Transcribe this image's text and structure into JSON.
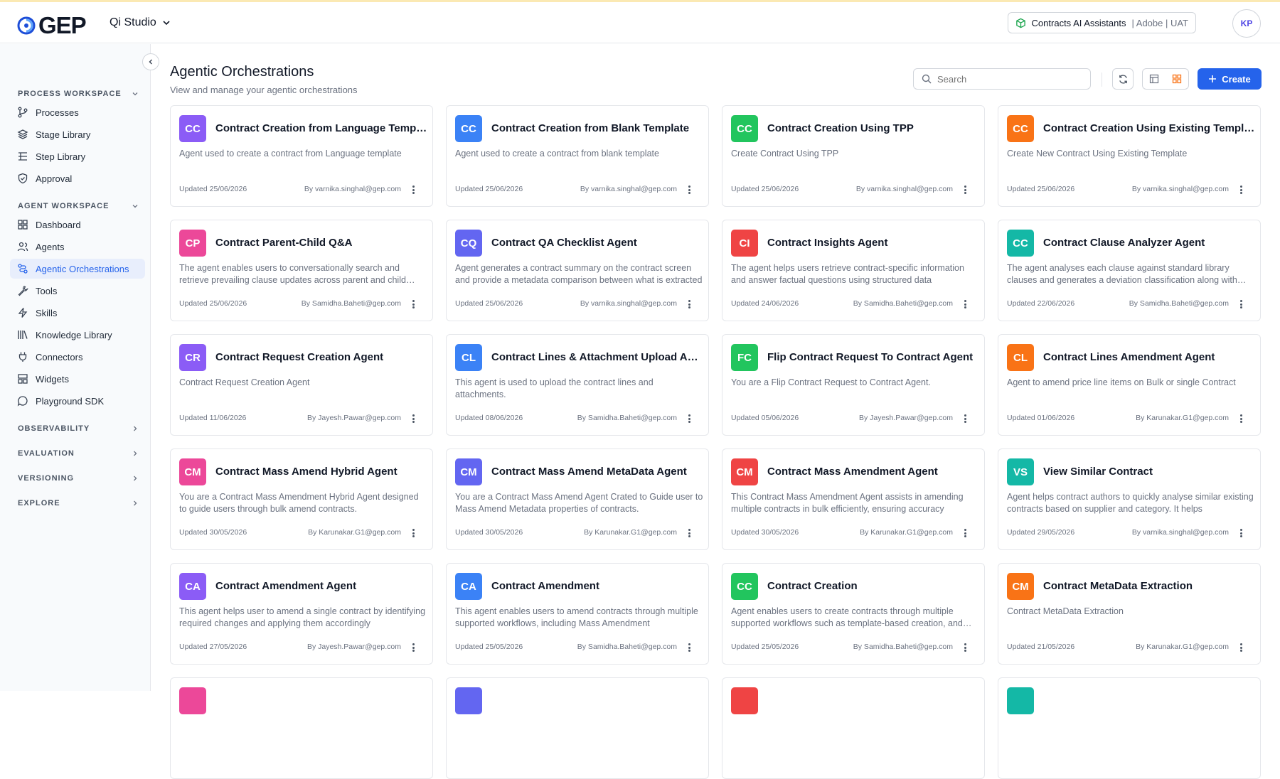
{
  "header": {
    "brand": "GEP",
    "studio_name": "Qi Studio",
    "context_name": "Contracts AI Assistants",
    "context_meta": "| Adobe | UAT",
    "user_initials": "KP"
  },
  "sidebar": {
    "sections": {
      "process": "PROCESS WORKSPACE",
      "agent": "AGENT WORKSPACE",
      "observability": "OBSERVABILITY",
      "evaluation": "EVALUATION",
      "versioning": "VERSIONING",
      "explore": "EXPLORE"
    },
    "process_items": [
      "Processes",
      "Stage Library",
      "Step Library",
      "Approval"
    ],
    "agent_items": [
      "Dashboard",
      "Agents",
      "Agentic Orchestrations",
      "Tools",
      "Skills",
      "Knowledge Library",
      "Connectors",
      "Widgets",
      "Playground SDK"
    ],
    "active_item": "Agentic Orchestrations"
  },
  "page": {
    "title": "Agentic Orchestrations",
    "subtitle": "View and manage your agentic orchestrations",
    "search_placeholder": "Search",
    "create_label": "Create",
    "active_view": "grid"
  },
  "colors": {
    "accent": "#2563eb",
    "purple": "#8b5cf6",
    "blue": "#3b82f6",
    "green": "#22c55e",
    "orange": "#f97316",
    "pink": "#ec4899",
    "indigo": "#6366f1",
    "red": "#ef4444",
    "teal": "#14b8a6"
  },
  "cards": [
    {
      "initials": "CC",
      "color": "#8b5cf6",
      "title": "Contract Creation from Language Template",
      "desc": "Agent used to create a contract from Language template",
      "updated": "Updated 25/06/2026",
      "by": "By varnika.singhal@gep.com"
    },
    {
      "initials": "CC",
      "color": "#3b82f6",
      "title": "Contract Creation from Blank Template",
      "desc": "Agent used to create a contract from blank template",
      "updated": "Updated 25/06/2026",
      "by": "By varnika.singhal@gep.com"
    },
    {
      "initials": "CC",
      "color": "#22c55e",
      "title": "Contract Creation Using TPP",
      "desc": "Create Contract Using TPP",
      "updated": "Updated 25/06/2026",
      "by": "By varnika.singhal@gep.com"
    },
    {
      "initials": "CC",
      "color": "#f97316",
      "title": "Contract Creation Using Existing Template",
      "desc": "Create New Contract Using Existing Template",
      "updated": "Updated 25/06/2026",
      "by": "By varnika.singhal@gep.com"
    },
    {
      "initials": "CP",
      "color": "#ec4899",
      "title": "Contract Parent-Child Q&A",
      "desc": "The agent enables users to conversationally search and retrieve prevailing clause updates across parent and child contracts",
      "updated": "Updated 25/06/2026",
      "by": "By Samidha.Baheti@gep.com"
    },
    {
      "initials": "CQ",
      "color": "#6366f1",
      "title": "Contract QA Checklist Agent",
      "desc": "Agent generates a contract summary on the contract screen and provide a metadata comparison between what is extracted",
      "updated": "Updated 25/06/2026",
      "by": "By varnika.singhal@gep.com"
    },
    {
      "initials": "CI",
      "color": "#ef4444",
      "title": "Contract Insights Agent",
      "desc": "The agent helps users retrieve contract-specific information and answer factual questions using structured data",
      "updated": "Updated 24/06/2026",
      "by": "By Samidha.Baheti@gep.com"
    },
    {
      "initials": "CC",
      "color": "#14b8a6",
      "title": "Contract Clause Analyzer Agent",
      "desc": "The agent analyses each clause against standard library clauses and generates a deviation classification along with reasoning",
      "updated": "Updated 22/06/2026",
      "by": "By Samidha.Baheti@gep.com"
    },
    {
      "initials": "CR",
      "color": "#8b5cf6",
      "title": "Contract Request Creation Agent",
      "desc": "Contract Request Creation Agent",
      "updated": "Updated 11/06/2026",
      "by": "By Jayesh.Pawar@gep.com"
    },
    {
      "initials": "CL",
      "color": "#3b82f6",
      "title": "Contract Lines & Attachment Upload Agent",
      "desc": "This agent is used to upload the contract lines and attachments.",
      "updated": "Updated 08/06/2026",
      "by": "By Samidha.Baheti@gep.com"
    },
    {
      "initials": "FC",
      "color": "#22c55e",
      "title": "Flip Contract Request To Contract Agent",
      "desc": "You are a Flip Contract Request to Contract Agent.",
      "updated": "Updated 05/06/2026",
      "by": "By Jayesh.Pawar@gep.com"
    },
    {
      "initials": "CL",
      "color": "#f97316",
      "title": "Contract Lines Amendment Agent",
      "desc": "Agent to amend price line items on Bulk or single Contract",
      "updated": "Updated 01/06/2026",
      "by": "By Karunakar.G1@gep.com"
    },
    {
      "initials": "CM",
      "color": "#ec4899",
      "title": "Contract Mass Amend Hybrid Agent",
      "desc": "You are a Contract Mass Amendment Hybrid Agent designed to guide users through bulk amend contracts.",
      "updated": "Updated 30/05/2026",
      "by": "By Karunakar.G1@gep.com"
    },
    {
      "initials": "CM",
      "color": "#6366f1",
      "title": "Contract Mass Amend MetaData Agent",
      "desc": "You are a Contract Mass Amend Agent Crated to Guide user to Mass Amend Metadata properties of contracts.",
      "updated": "Updated 30/05/2026",
      "by": "By Karunakar.G1@gep.com"
    },
    {
      "initials": "CM",
      "color": "#ef4444",
      "title": "Contract Mass Amendment Agent",
      "desc": "This Contract Mass Amendment Agent assists in amending multiple contracts in bulk efficiently, ensuring accuracy",
      "updated": "Updated 30/05/2026",
      "by": "By Karunakar.G1@gep.com"
    },
    {
      "initials": "VS",
      "color": "#14b8a6",
      "title": "View Similar Contract",
      "desc": "Agent helps contract authors to quickly analyse similar existing contracts based on supplier and category. It helps",
      "updated": "Updated 29/05/2026",
      "by": "By varnika.singhal@gep.com"
    },
    {
      "initials": "CA",
      "color": "#8b5cf6",
      "title": "Contract Amendment Agent",
      "desc": "This agent helps user to amend a single contract by identifying required changes and applying them accordingly",
      "updated": "Updated 27/05/2026",
      "by": "By Jayesh.Pawar@gep.com"
    },
    {
      "initials": "CA",
      "color": "#3b82f6",
      "title": "Contract Amendment",
      "desc": "This agent enables users to amend contracts through multiple supported workflows, including Mass Amendment",
      "updated": "Updated 25/05/2026",
      "by": "By Samidha.Baheti@gep.com"
    },
    {
      "initials": "CC",
      "color": "#22c55e",
      "title": "Contract Creation",
      "desc": "Agent enables users to create contracts through multiple supported workflows such as template-based creation, and more",
      "updated": "Updated 25/05/2026",
      "by": "By Samidha.Baheti@gep.com"
    },
    {
      "initials": "CM",
      "color": "#f97316",
      "title": "Contract MetaData Extraction",
      "desc": "Contract MetaData Extraction",
      "updated": "Updated 21/05/2026",
      "by": "By Karunakar.G1@gep.com"
    },
    {
      "initials": "",
      "color": "#ec4899",
      "title": "",
      "desc": "",
      "updated": "",
      "by": ""
    },
    {
      "initials": "",
      "color": "#6366f1",
      "title": "",
      "desc": "",
      "updated": "",
      "by": ""
    },
    {
      "initials": "",
      "color": "#ef4444",
      "title": "",
      "desc": "",
      "updated": "",
      "by": ""
    },
    {
      "initials": "",
      "color": "#14b8a6",
      "title": "",
      "desc": "",
      "updated": "",
      "by": ""
    }
  ]
}
